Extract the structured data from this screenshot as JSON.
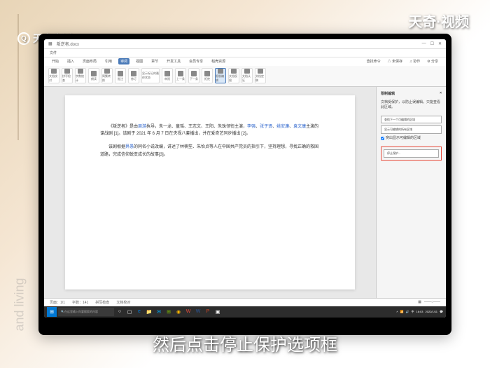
{
  "branding": {
    "logo_text": "天奇生活",
    "video_text": "天奇·视频"
  },
  "subtitle": "然后点击停止保护选项框",
  "titlebar": {
    "doc_name": "叛逆者.docx"
  },
  "menubar": {
    "items": [
      "文件"
    ]
  },
  "ribbon_tabs": {
    "items": [
      "开始",
      "插入",
      "页面布局",
      "引用",
      "审阅",
      "视图",
      "章节",
      "开发工具",
      "会员专享",
      "稻壳资源"
    ],
    "active_index": 4,
    "right": [
      "查找命令",
      "△ 未保存",
      "♫ 协作",
      "⚙ 分享"
    ]
  },
  "ribbon": {
    "buttons": [
      "文档校对",
      "拼写检查",
      "字数统计",
      "朗读",
      "简繁转换",
      "批注",
      "修订",
      "显示标记的最终状态",
      "审阅",
      "上一条",
      "下一条",
      "拒绝",
      "限制编辑",
      "文档权限",
      "文档认证",
      "文档定稿"
    ],
    "active_index": 12
  },
  "document": {
    "para1_pre": "《叛逆者》是由",
    "para1_link1": "周游",
    "para1_mid1": "执导，朱一龙、童瑶、王志文、王阳、朱珠领衔主演，",
    "para1_link2": "李强",
    "para1_mid2": "、",
    "para1_link3": "张子贤",
    "para1_mid3": "、",
    "para1_link4": "姚安濂",
    "para1_mid4": "、",
    "para1_link5": "袁文康",
    "para1_post": "主演的谍战剧 [1]。该剧于 2021 年 6 月 7 日在央视八套播出，并在爱奇艺同步播出 [2]。",
    "para2_pre": "该剧根据",
    "para2_link1": "畀愚",
    "para2_post": "的同名小说改编，讲述了林楠笙、朱怡贞等人在中国共产党员的指引下，坚持理想，寻找正确的救国道路，完成信仰蜕变成长的故事[3]。"
  },
  "side_panel": {
    "title": "限制编辑",
    "close": "×",
    "section1": "文档受保护，以防止误编辑。只能查看此区域。",
    "btn1": "查找下一个可编辑的区域",
    "btn2": "显示可编辑的所有区域",
    "checkbox_label": "突出显示可编辑的区域",
    "stop_protect": "停止保护..."
  },
  "statusbar": {
    "page": "页面：1/1",
    "words": "字数：141",
    "mode": "拼写检查",
    "input": "文档校对"
  },
  "taskbar": {
    "search_placeholder": "在这里输入你要搜索的内容",
    "time": "16:03",
    "date": "2022/1/11"
  },
  "colors": {
    "accent": "#4a7ab8",
    "highlight": "#e74c3c"
  }
}
